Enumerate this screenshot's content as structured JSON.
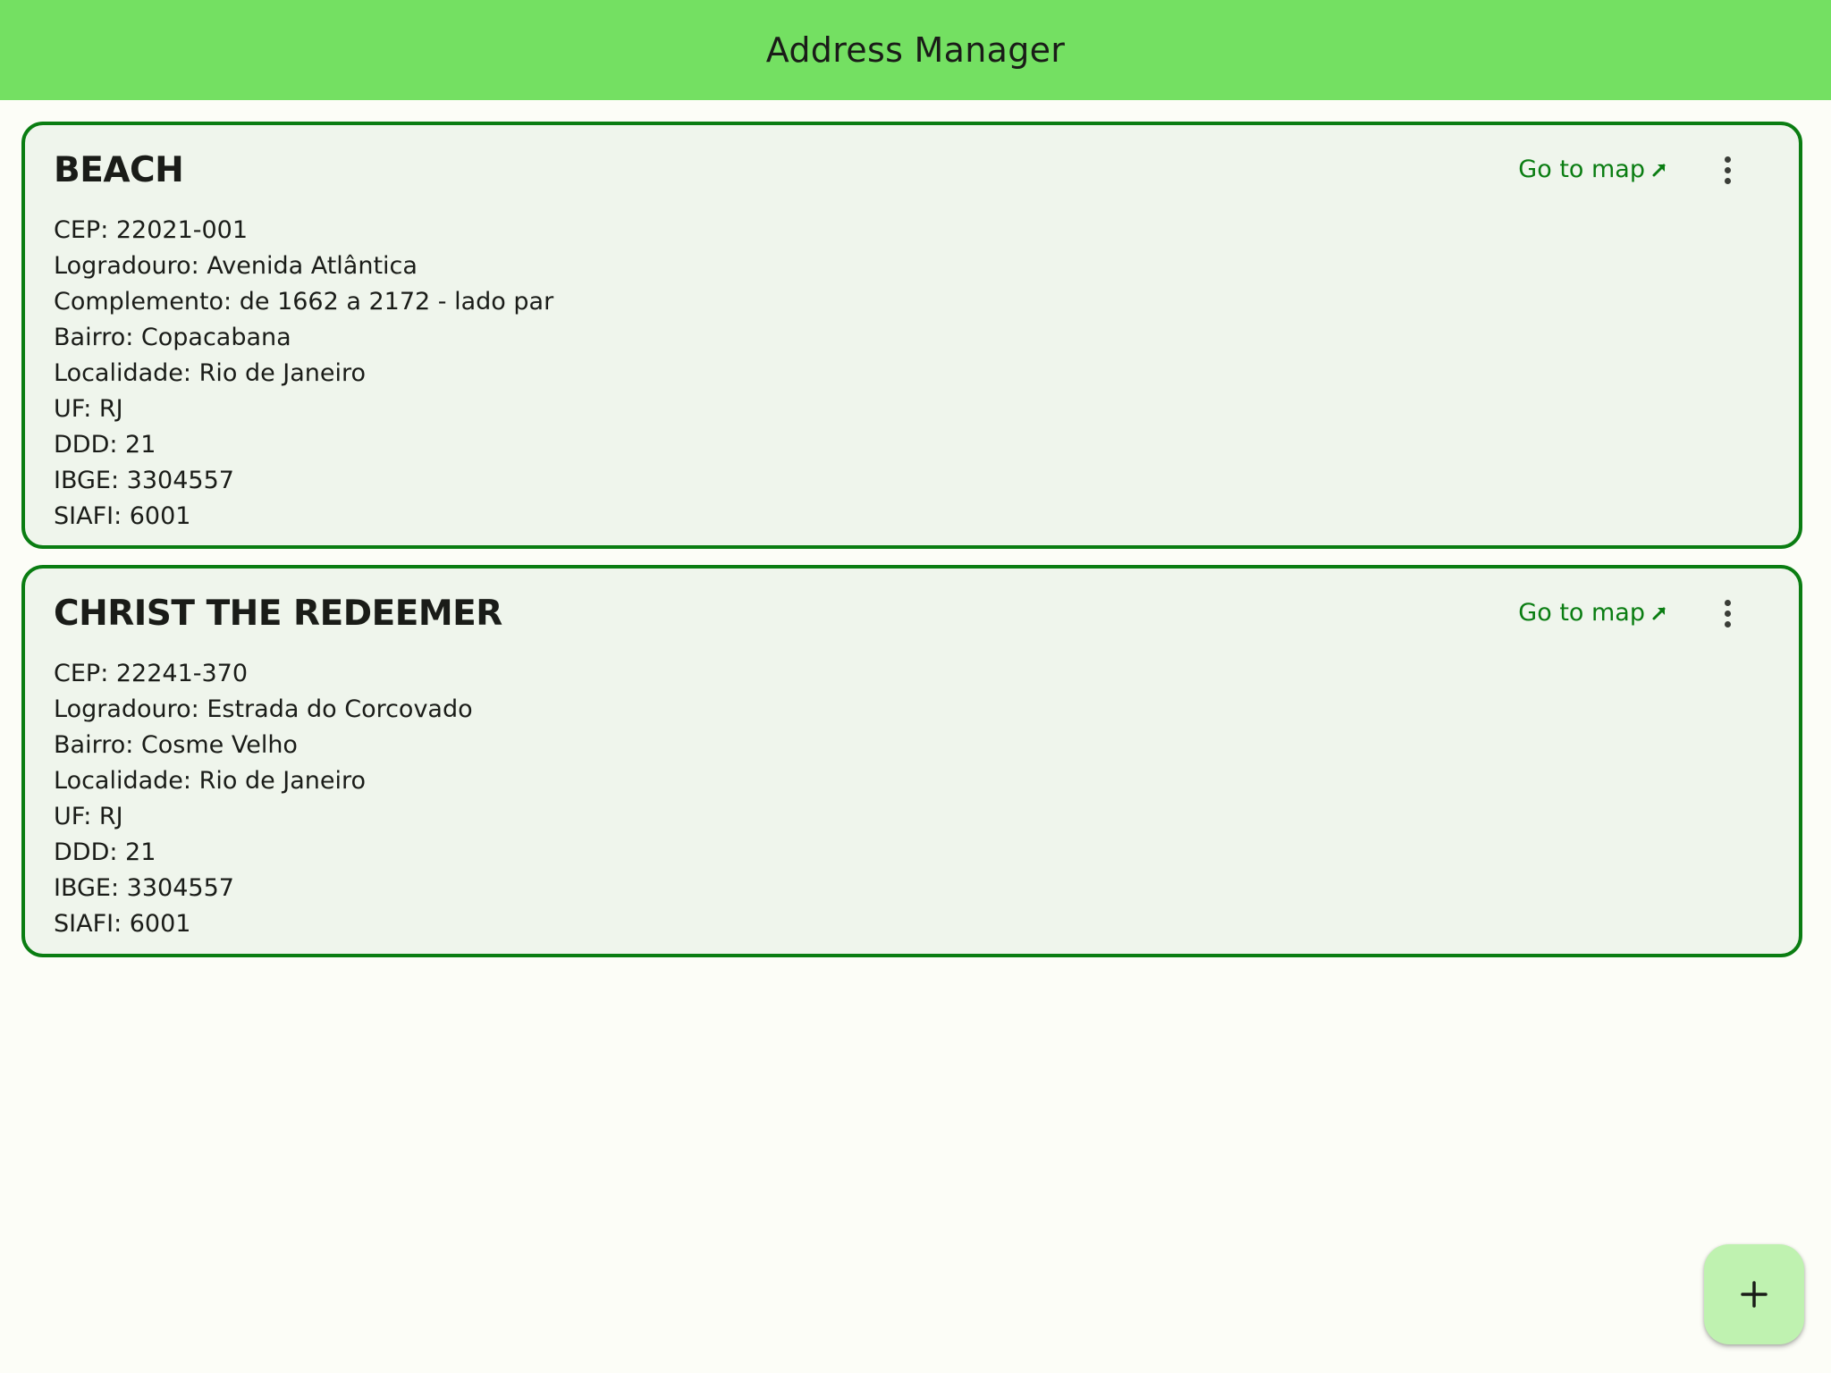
{
  "app_bar": {
    "title": "Address Manager"
  },
  "cards": [
    {
      "title": "BEACH",
      "map_link_label": "Go to map",
      "fields": [
        "CEP: 22021-001",
        "Logradouro: Avenida Atlântica",
        "Complemento: de 1662 a 2172 - lado par",
        "Bairro: Copacabana",
        "Localidade: Rio de Janeiro",
        "UF: RJ",
        "DDD: 21",
        "IBGE: 3304557",
        "SIAFI: 6001"
      ]
    },
    {
      "title": "CHRIST THE REDEEMER",
      "map_link_label": "Go to map",
      "fields": [
        "CEP: 22241-370",
        "Logradouro: Estrada do Corcovado",
        "Bairro: Cosme Velho",
        "Localidade: Rio de Janeiro",
        "UF: RJ",
        "DDD: 21",
        "IBGE: 3304557",
        "SIAFI: 6001"
      ]
    }
  ],
  "icons": {
    "map_link": "arrow-outward-icon",
    "menu": "more-vert-icon",
    "fab": "plus-icon"
  },
  "colors": {
    "app_bar": "#74e062",
    "accent": "#0a7d12",
    "card_background": "#eff5ec",
    "fab_background": "#bff2b0"
  }
}
